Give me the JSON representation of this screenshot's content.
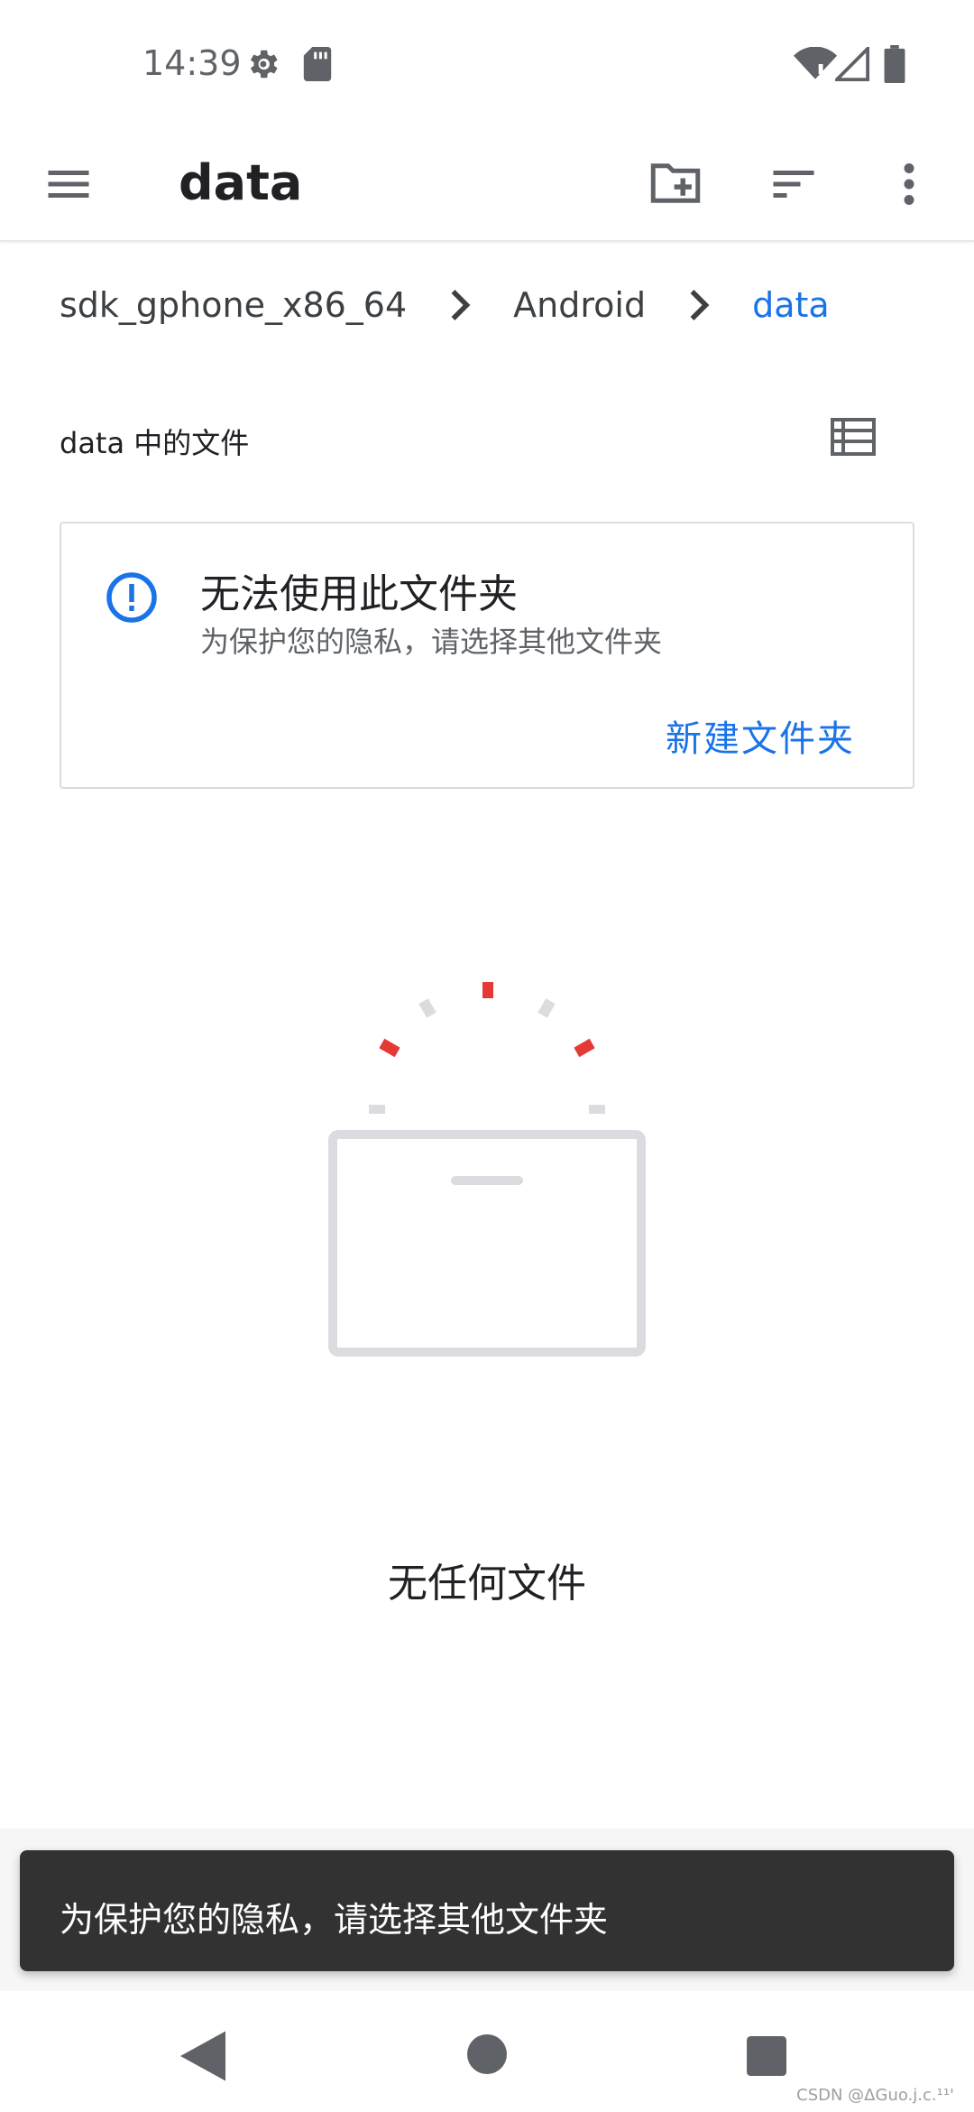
{
  "status_bar": {
    "time": "14:39",
    "icons": [
      "gear-icon",
      "sd-card-icon",
      "wifi-icon",
      "signal-icon",
      "battery-icon"
    ]
  },
  "app_bar": {
    "title": "data",
    "icons": [
      "menu-icon",
      "new-folder-icon",
      "sort-icon",
      "more-vert-icon"
    ]
  },
  "breadcrumb": {
    "items": [
      "sdk_gphone_x86_64",
      "Android",
      "data"
    ]
  },
  "section": {
    "title": "data 中的文件"
  },
  "warning_card": {
    "title": "无法使用此文件夹",
    "subtitle": "为保护您的隐私，请选择其他文件夹",
    "action_label": "新建文件夹"
  },
  "empty_state": {
    "text": "无任何文件"
  },
  "snackbar": {
    "text": "为保护您的隐私，请选择其他文件夹"
  },
  "watermark": "CSDN @ΔGuo.j.c.¹¹'",
  "colors": {
    "accent": "#1a73e8",
    "text_primary": "#202124",
    "text_secondary": "#5f6368",
    "icon_grey": "#5f6368",
    "illustration_grey": "#dadce0",
    "illustration_red": "#e53935",
    "snackbar_bg": "#323232"
  }
}
